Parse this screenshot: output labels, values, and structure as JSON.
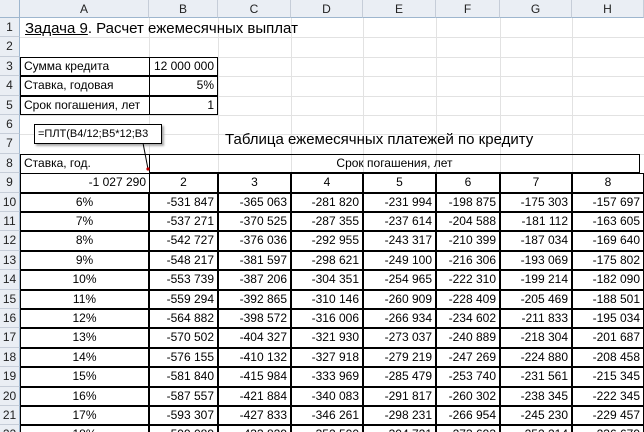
{
  "columns": [
    "A",
    "B",
    "C",
    "D",
    "E",
    "F",
    "G",
    "H"
  ],
  "rows": [
    "1",
    "2",
    "3",
    "4",
    "5",
    "6",
    "7",
    "8",
    "9",
    "10",
    "11",
    "12",
    "13",
    "14",
    "15",
    "16",
    "17",
    "18",
    "19",
    "20",
    "21",
    "22"
  ],
  "title": {
    "prefix": "Задача 9",
    "rest": ". Расчет ежемесячных выплат"
  },
  "inputs": [
    {
      "label": "Сумма кредита",
      "value": "12 000 000"
    },
    {
      "label": "Ставка, годовая",
      "value": "5%"
    },
    {
      "label": "Срок погашения, лет",
      "value": "1"
    }
  ],
  "formula_tooltip": "=ПЛТ(B4/12;B5*12;B3",
  "table_title": "Таблица ежемесячных платежей по кредиту",
  "rate_header": "Ставка, год.",
  "term_header": "Срок погашения, лет",
  "corner_value": "-1 027 290",
  "terms": [
    "2",
    "3",
    "4",
    "5",
    "6",
    "7",
    "8"
  ],
  "table": [
    {
      "rate": "6%",
      "values": [
        "-531 847",
        "-365 063",
        "-281 820",
        "-231 994",
        "-198 875",
        "-175 303",
        "-157 697"
      ]
    },
    {
      "rate": "7%",
      "values": [
        "-537 271",
        "-370 525",
        "-287 355",
        "-237 614",
        "-204 588",
        "-181 112",
        "-163 605"
      ]
    },
    {
      "rate": "8%",
      "values": [
        "-542 727",
        "-376 036",
        "-292 955",
        "-243 317",
        "-210 399",
        "-187 034",
        "-169 640"
      ]
    },
    {
      "rate": "9%",
      "values": [
        "-548 217",
        "-381 597",
        "-298 621",
        "-249 100",
        "-216 306",
        "-193 069",
        "-175 802"
      ]
    },
    {
      "rate": "10%",
      "values": [
        "-553 739",
        "-387 206",
        "-304 351",
        "-254 965",
        "-222 310",
        "-199 214",
        "-182 090"
      ]
    },
    {
      "rate": "11%",
      "values": [
        "-559 294",
        "-392 865",
        "-310 146",
        "-260 909",
        "-228 409",
        "-205 469",
        "-188 501"
      ]
    },
    {
      "rate": "12%",
      "values": [
        "-564 882",
        "-398 572",
        "-316 006",
        "-266 934",
        "-234 602",
        "-211 833",
        "-195 034"
      ]
    },
    {
      "rate": "13%",
      "values": [
        "-570 502",
        "-404 327",
        "-321 930",
        "-273 037",
        "-240 889",
        "-218 304",
        "-201 687"
      ]
    },
    {
      "rate": "14%",
      "values": [
        "-576 155",
        "-410 132",
        "-327 918",
        "-279 219",
        "-247 269",
        "-224 880",
        "-208 458"
      ]
    },
    {
      "rate": "15%",
      "values": [
        "-581 840",
        "-415 984",
        "-333 969",
        "-285 479",
        "-253 740",
        "-231 561",
        "-215 345"
      ]
    },
    {
      "rate": "16%",
      "values": [
        "-587 557",
        "-421 884",
        "-340 083",
        "-291 817",
        "-260 302",
        "-238 345",
        "-222 345"
      ]
    },
    {
      "rate": "17%",
      "values": [
        "-593 307",
        "-427 833",
        "-346 261",
        "-298 231",
        "-266 954",
        "-245 230",
        "-229 457"
      ]
    },
    {
      "rate": "18%",
      "values": [
        "-599 089",
        "-433 829",
        "-352 500",
        "-304 721",
        "-273 693",
        "-252 214",
        "-236 679"
      ]
    }
  ]
}
